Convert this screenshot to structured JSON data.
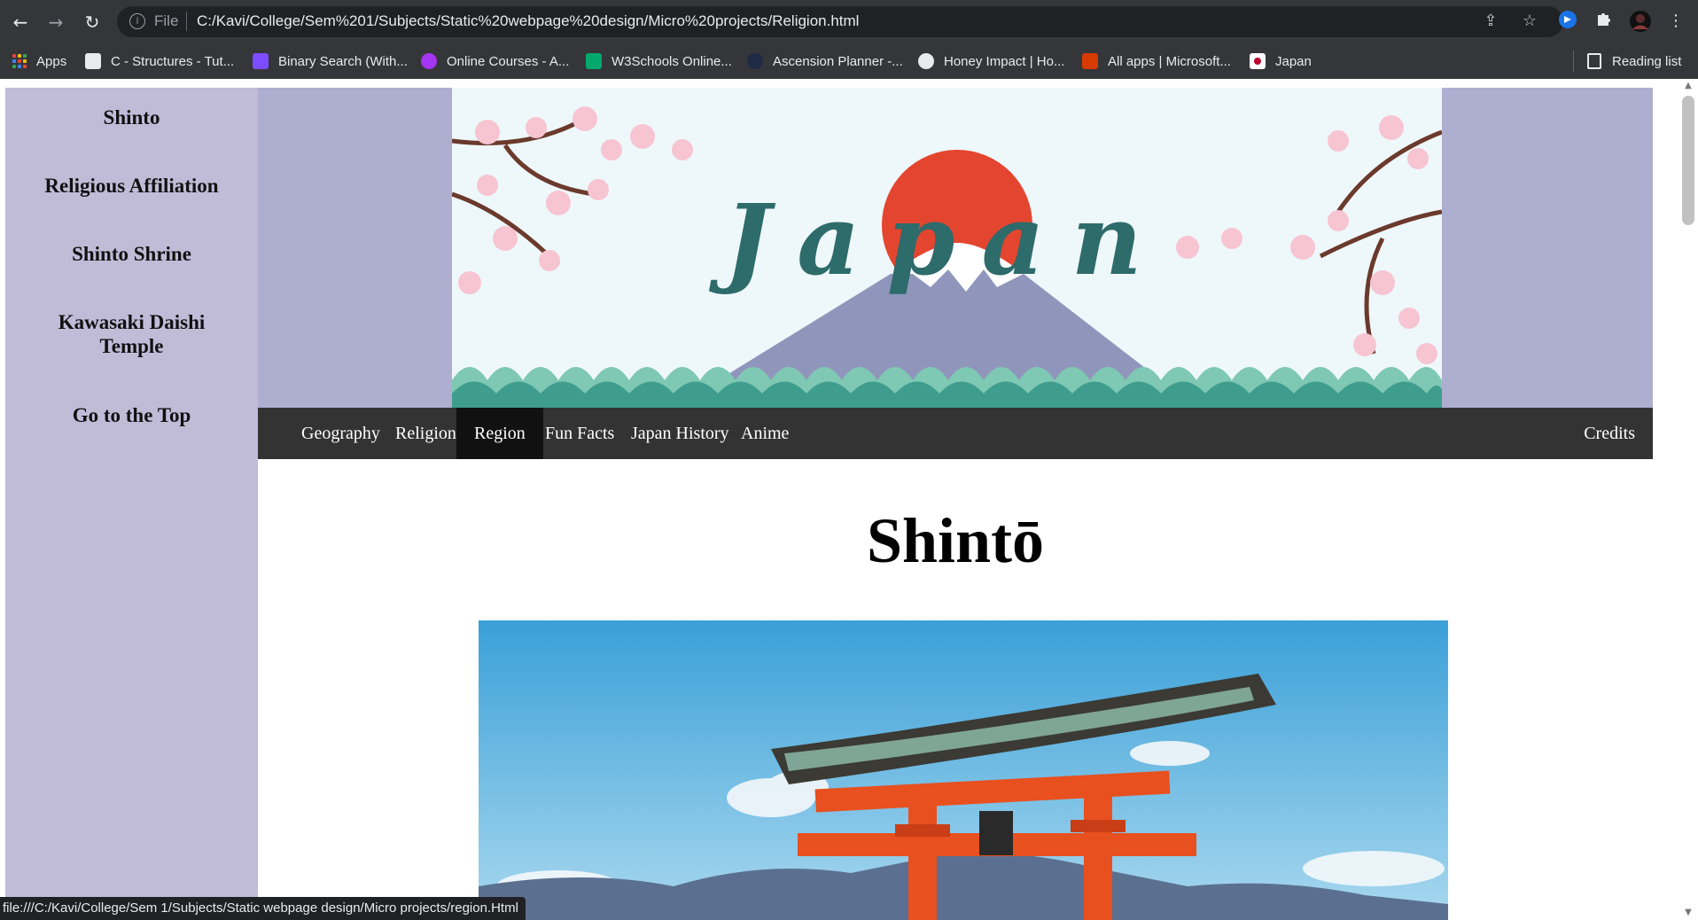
{
  "browser": {
    "file_label": "File",
    "url": "C:/Kavi/College/Sem%201/Subjects/Static%20webpage%20design/Micro%20projects/Religion.html",
    "status_url": "file:///C:/Kavi/College/Sem 1/Subjects/Static webpage design/Micro projects/region.Html",
    "bookmarks": [
      {
        "label": "Apps",
        "icon": "apps-grid-icon"
      },
      {
        "label": "C - Structures - Tut...",
        "icon": "tutorial-site-icon",
        "color": "#e8eaed"
      },
      {
        "label": "Binary Search (With...",
        "icon": "programiz-icon",
        "color": "#7c4dff"
      },
      {
        "label": "Online Courses - A...",
        "icon": "udemy-icon",
        "color": "#a435f0"
      },
      {
        "label": "W3Schools Online...",
        "icon": "w3schools-icon",
        "color": "#04aa6d"
      },
      {
        "label": "Ascension Planner -...",
        "icon": "genshin-center-icon",
        "color": "#1f2a44"
      },
      {
        "label": "Honey Impact | Ho...",
        "icon": "honey-impact-icon",
        "color": "#e8eaed"
      },
      {
        "label": "All apps | Microsoft...",
        "icon": "office-icon",
        "color": "#d83b01"
      },
      {
        "label": "Japan",
        "icon": "japan-flag-icon",
        "color": "#bc002d"
      }
    ],
    "reading_list": "Reading list"
  },
  "sidebar": {
    "items": [
      {
        "label": "Shinto"
      },
      {
        "label": "Religious Affiliation"
      },
      {
        "label": "Shinto Shrine"
      },
      {
        "label": "Kawasaki Daishi Temple"
      },
      {
        "label": "Go to the Top"
      }
    ]
  },
  "banner": {
    "title": "Japan"
  },
  "nav": {
    "items": [
      {
        "label": "Geography",
        "active": false
      },
      {
        "label": "Religion",
        "active": false
      },
      {
        "label": "Region",
        "active": true
      },
      {
        "label": "Fun Facts",
        "active": false
      },
      {
        "label": "Japan History",
        "active": false
      },
      {
        "label": "Anime",
        "active": false
      }
    ],
    "credits": "Credits"
  },
  "main": {
    "title": "Shintō"
  },
  "colors": {
    "sidebar_bg": "#c0bcd8",
    "header_bg": "#aeaed0",
    "navbar_bg": "#333333",
    "nav_active_bg": "#111111",
    "sun": "#e4452f",
    "mountain": "#9096bb",
    "banner_text": "#2e6b6b",
    "torii": "#e8501f"
  }
}
